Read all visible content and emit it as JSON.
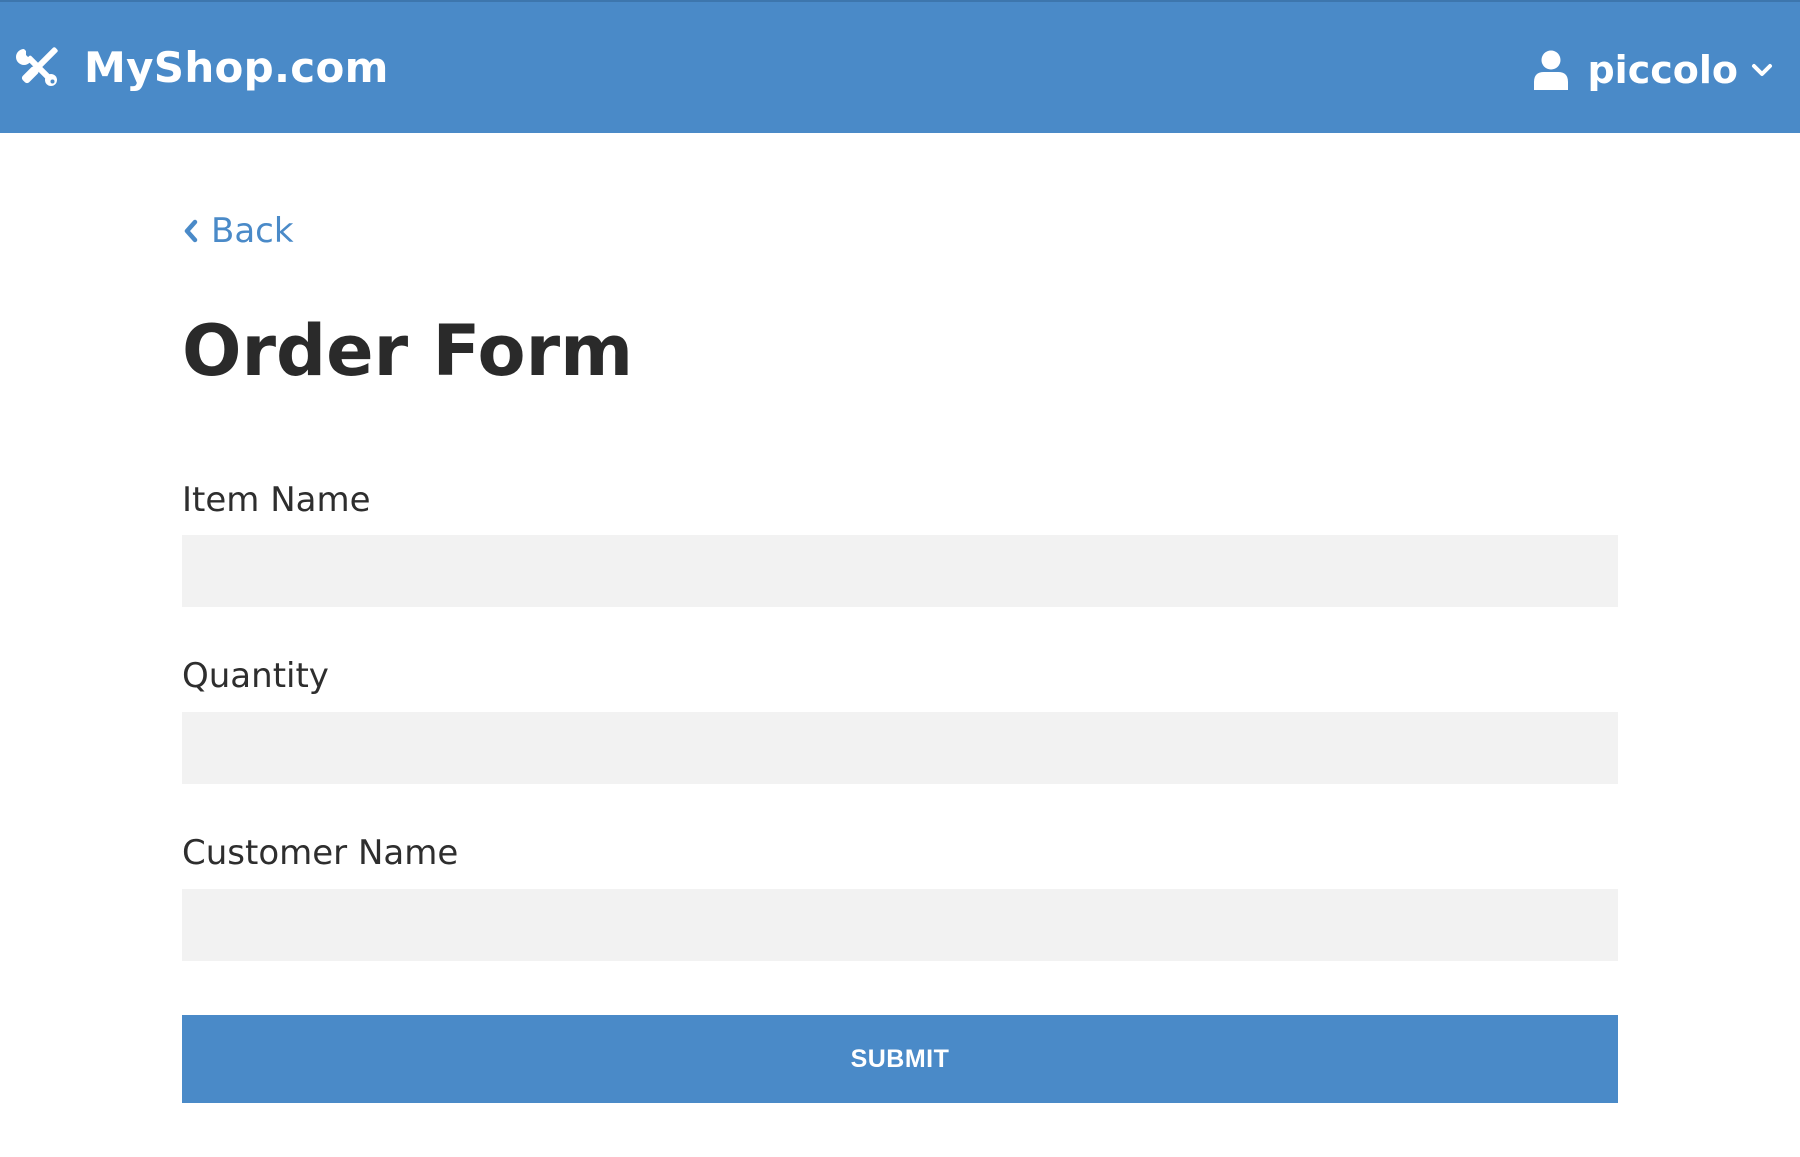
{
  "header": {
    "brand_name": "MyShop.com",
    "brand_icon": "tools-icon",
    "user": {
      "name": "piccolo",
      "icon": "user-icon",
      "menu_icon": "chevron-down-icon"
    },
    "background_color": "#4a8ac8"
  },
  "nav": {
    "back_label": "Back",
    "back_icon": "chevron-left-icon"
  },
  "page": {
    "title": "Order Form"
  },
  "form": {
    "fields": [
      {
        "label": "Item Name",
        "value": "",
        "placeholder": ""
      },
      {
        "label": "Quantity",
        "value": "",
        "placeholder": ""
      },
      {
        "label": "Customer Name",
        "value": "",
        "placeholder": ""
      }
    ],
    "submit_label": "SUBMIT"
  },
  "colors": {
    "accent": "#4a8ac8",
    "input_background": "#f2f2f2",
    "title_text": "#2a2a2a"
  }
}
